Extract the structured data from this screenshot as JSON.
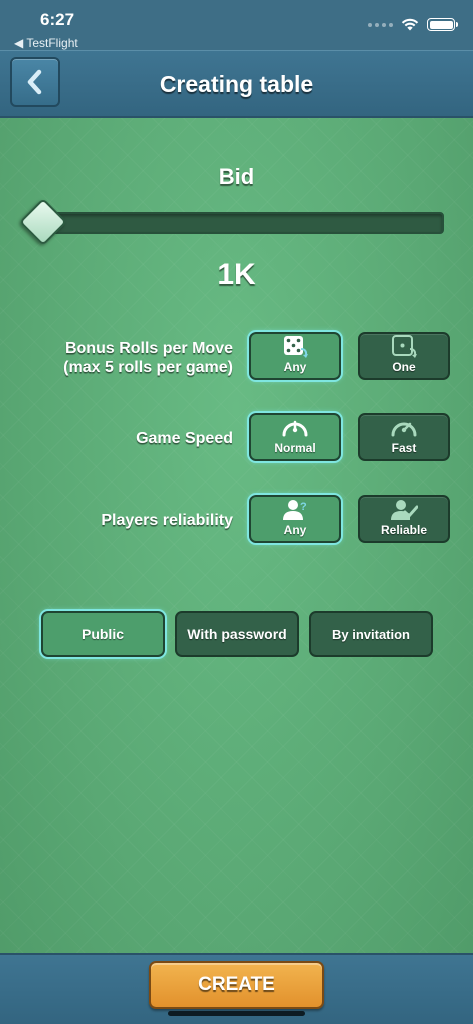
{
  "status": {
    "time": "6:27",
    "back_app": "◀ TestFlight"
  },
  "header": {
    "title": "Creating table"
  },
  "bid": {
    "label": "Bid",
    "value": "1K",
    "slider_fraction": 0.0
  },
  "options": {
    "bonus_rolls": {
      "label_line1": "Bonus Rolls per Move",
      "label_line2": "(max 5 rolls per game)",
      "choices": [
        "Any",
        "One"
      ],
      "selected": "Any"
    },
    "game_speed": {
      "label": "Game Speed",
      "choices": [
        "Normal",
        "Fast"
      ],
      "selected": "Normal"
    },
    "reliability": {
      "label": "Players reliability",
      "choices": [
        "Any",
        "Reliable"
      ],
      "selected": "Any"
    }
  },
  "visibility": {
    "choices": [
      "Public",
      "With password",
      "By invitation"
    ],
    "selected": "Public"
  },
  "footer": {
    "create_label": "CREATE"
  },
  "colors": {
    "felt_green": "#5fb07a",
    "header_blue": "#3f7592",
    "selected_glow": "#7fe6e0",
    "create_orange": "#eba23d"
  },
  "icons": {
    "back": "chevron-left-icon",
    "dice_any": "dice-five-icon",
    "dice_one": "dice-one-icon",
    "speed_normal": "speedometer-normal-icon",
    "speed_fast": "speedometer-fast-icon",
    "reliability_any": "user-question-icon",
    "reliability_reliable": "user-check-icon"
  }
}
